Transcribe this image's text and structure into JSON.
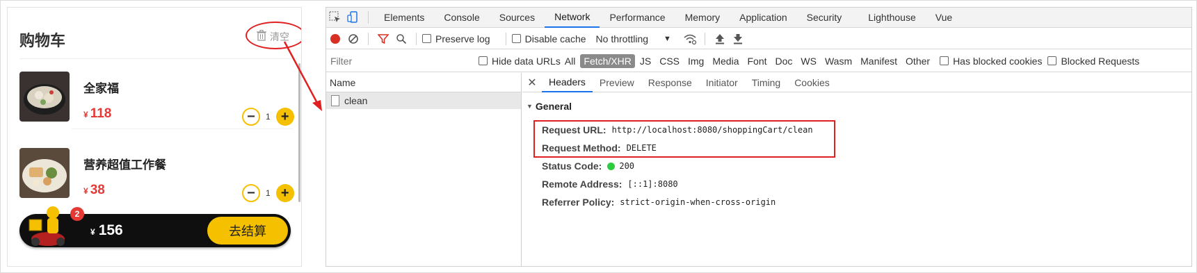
{
  "cart": {
    "title": "购物车",
    "clear_label": "清空",
    "items": [
      {
        "name": "全家福",
        "currency": "¥",
        "price": "118",
        "qty": "1"
      },
      {
        "name": "营养超值工作餐",
        "currency": "¥",
        "price": "38",
        "qty": "1"
      }
    ],
    "badge_count": "2",
    "total_currency": "¥",
    "total": "156",
    "checkout_label": "去结算",
    "accent_color": "#f5c000",
    "price_color": "#e53935"
  },
  "devtools": {
    "tabs": [
      "Elements",
      "Console",
      "Sources",
      "Network",
      "Performance",
      "Memory",
      "Application",
      "Security",
      "Lighthouse",
      "Vue"
    ],
    "active_tab": "Network",
    "toolbar": {
      "preserve_log": "Preserve log",
      "disable_cache": "Disable cache",
      "throttling": "No throttling"
    },
    "filter": {
      "placeholder": "Filter",
      "hide_data_urls": "Hide data URLs",
      "types": [
        "All",
        "Fetch/XHR",
        "JS",
        "CSS",
        "Img",
        "Media",
        "Font",
        "Doc",
        "WS",
        "Wasm",
        "Manifest",
        "Other"
      ],
      "active_type": "Fetch/XHR",
      "has_blocked_cookies": "Has blocked cookies",
      "blocked_requests": "Blocked Requests"
    },
    "name_column": "Name",
    "request_name": "clean",
    "detail_tabs": [
      "Headers",
      "Preview",
      "Response",
      "Initiator",
      "Timing",
      "Cookies"
    ],
    "active_detail_tab": "Headers",
    "general": {
      "heading": "General",
      "fields": [
        {
          "key": "Request URL:",
          "value": "http://localhost:8080/shoppingCart/clean"
        },
        {
          "key": "Request Method:",
          "value": "DELETE"
        },
        {
          "key": "Status Code:",
          "value": "200"
        },
        {
          "key": "Remote Address:",
          "value": "[::1]:8080"
        },
        {
          "key": "Referrer Policy:",
          "value": "strict-origin-when-cross-origin"
        }
      ]
    }
  }
}
